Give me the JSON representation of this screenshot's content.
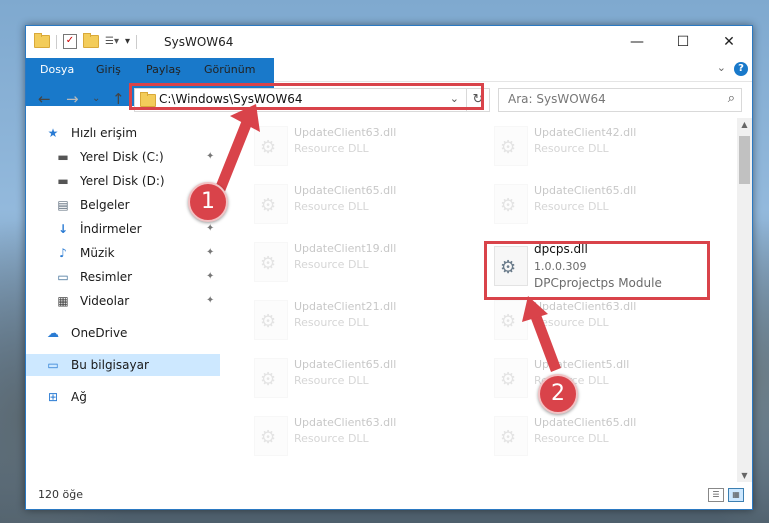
{
  "window": {
    "title": "SysWOW64",
    "controls": {
      "minimize": "—",
      "maximize": "☐",
      "close": "✕"
    }
  },
  "ribbon": {
    "tabs": [
      "Dosya",
      "Giriş",
      "Paylaş",
      "Görünüm"
    ],
    "help": "?",
    "collapse": "⌄"
  },
  "navigation": {
    "back": "←",
    "forward": "→",
    "recent": "⌄",
    "up": "↑",
    "address": "C:\\Windows\\SysWOW64",
    "address_dropdown": "⌄",
    "refresh": "↻",
    "search_placeholder": "Ara: SysWOW64",
    "search_icon": "⌕"
  },
  "sidebar": {
    "items": [
      {
        "label": "Hızlı erişim",
        "icon": "star-icon",
        "glyph": "★",
        "pinned": false
      },
      {
        "label": "Yerel Disk (C:)",
        "icon": "drive-icon",
        "glyph": "▬",
        "pinned": true
      },
      {
        "label": "Yerel Disk (D:)",
        "icon": "drive-icon",
        "glyph": "▬",
        "pinned": false
      },
      {
        "label": "Belgeler",
        "icon": "documents-icon",
        "glyph": "▤",
        "pinned": true
      },
      {
        "label": "İndirmeler",
        "icon": "download-icon",
        "glyph": "↓",
        "pinned": true
      },
      {
        "label": "Müzik",
        "icon": "music-icon",
        "glyph": "♪",
        "pinned": true
      },
      {
        "label": "Resimler",
        "icon": "pictures-icon",
        "glyph": "▭",
        "pinned": true
      },
      {
        "label": "Videolar",
        "icon": "videos-icon",
        "glyph": "▦",
        "pinned": true
      },
      {
        "label": "OneDrive",
        "icon": "cloud-icon",
        "glyph": "☁",
        "pinned": false
      },
      {
        "label": "Bu bilgisayar",
        "icon": "computer-icon",
        "glyph": "▭",
        "pinned": false
      },
      {
        "label": "Ağ",
        "icon": "network-icon",
        "glyph": "⊞",
        "pinned": false
      }
    ],
    "pin_glyph": "📌"
  },
  "files": {
    "left_column": [
      {
        "name": "UpdateClient63.dll",
        "type": "Resource DLL"
      },
      {
        "name": "UpdateClient65.dll",
        "type": "Resource DLL"
      },
      {
        "name": "UpdateClient19.dll",
        "type": "Resource DLL"
      },
      {
        "name": "UpdateClient21.dll",
        "type": "Resource DLL"
      },
      {
        "name": "UpdateClient65.dll",
        "type": "Resource DLL"
      },
      {
        "name": "UpdateClient63.dll",
        "type": "Resource DLL"
      }
    ],
    "right_column": [
      {
        "name": "UpdateClient42.dll",
        "type": "Resource DLL"
      },
      {
        "name": "UpdateClient65.dll",
        "type": "Resource DLL"
      },
      {
        "name": "UpdateClient63.dll",
        "type": "Resource DLL"
      },
      {
        "name": "UpdateClient5.dll",
        "type": "Resource DLL"
      },
      {
        "name": "UpdateClient65.dll",
        "type": "Resource DLL"
      }
    ],
    "target": {
      "name": "dpcps.dll",
      "version": "1.0.0.309",
      "type": "DPCprojectps Module"
    }
  },
  "status": {
    "count": "120 öğe"
  },
  "annotations": {
    "step1": "1",
    "step2": "2",
    "color": "#d9434a"
  },
  "scrollbar": {
    "up": "▲",
    "down": "▼"
  },
  "view_modes": [
    "☰",
    "▦"
  ]
}
